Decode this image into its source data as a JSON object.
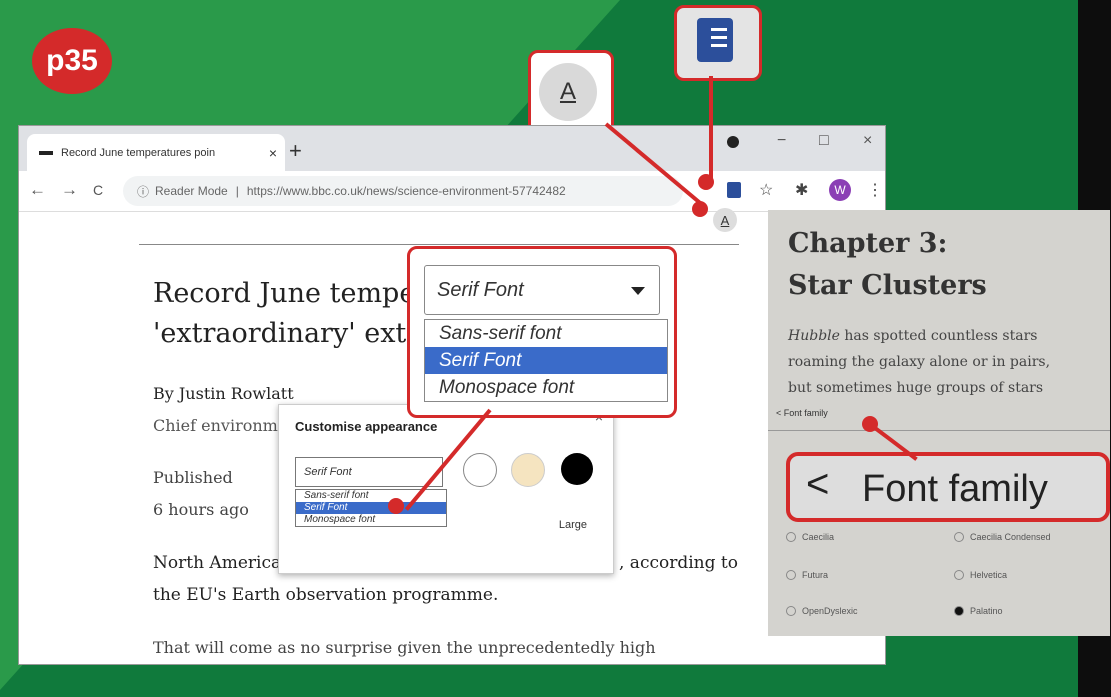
{
  "badge": "p35",
  "tab": {
    "title": "Record June temperatures poin",
    "close": "×",
    "new": "+"
  },
  "window": {
    "min": "−",
    "max": "□",
    "close": "×"
  },
  "nav": {
    "back": "←",
    "forward": "→",
    "reload": "C"
  },
  "omnibox": {
    "info": "ⓘ",
    "mode": "Reader Mode",
    "sep": "|",
    "url": "https://www.bbc.co.uk/news/science-environment-57742482"
  },
  "toolbar": {
    "star": "☆",
    "ext": "✱",
    "avatar": "W",
    "menu": "⋮",
    "appearance": "A"
  },
  "article": {
    "headline1": "Record June temper",
    "headline2": "'extraordinary' extre",
    "byline": "By Justin Rowlatt",
    "role": "Chief environme",
    "published": "Published",
    "ago": "6 hours ago",
    "p1a": "North America",
    "p1b": ", according to",
    "p1c": "the EU's Earth observation programme.",
    "p2": "That will come as no surprise given the unprecedentedly high"
  },
  "callout_a": "A",
  "dropdown": {
    "selected": "Serif Font",
    "options": [
      "Sans-serif font",
      "Serif Font",
      "Monospace font"
    ]
  },
  "customise": {
    "title": "Customise appearance",
    "close": "×",
    "selected": "Serif Font",
    "options": [
      "Sans-serif font",
      "Serif Font",
      "Monospace font"
    ],
    "size_label": "Large",
    "swatches": [
      "#ffffff",
      "#f5e4c0",
      "#000000"
    ]
  },
  "book": {
    "heading1": "Chapter 3:",
    "heading2": "Star Clusters",
    "line1_em": "Hubble",
    "line1": " has spotted countless stars",
    "line2": "roaming the galaxy alone or in pairs,",
    "line3": "but sometimes huge groups of stars",
    "small_label": "< Font family",
    "fontfamily": "Font family",
    "chevron": "<",
    "fonts": [
      "Caecilia",
      "Caecilia Condensed",
      "Futura",
      "Helvetica",
      "OpenDyslexic",
      "Palatino"
    ]
  }
}
